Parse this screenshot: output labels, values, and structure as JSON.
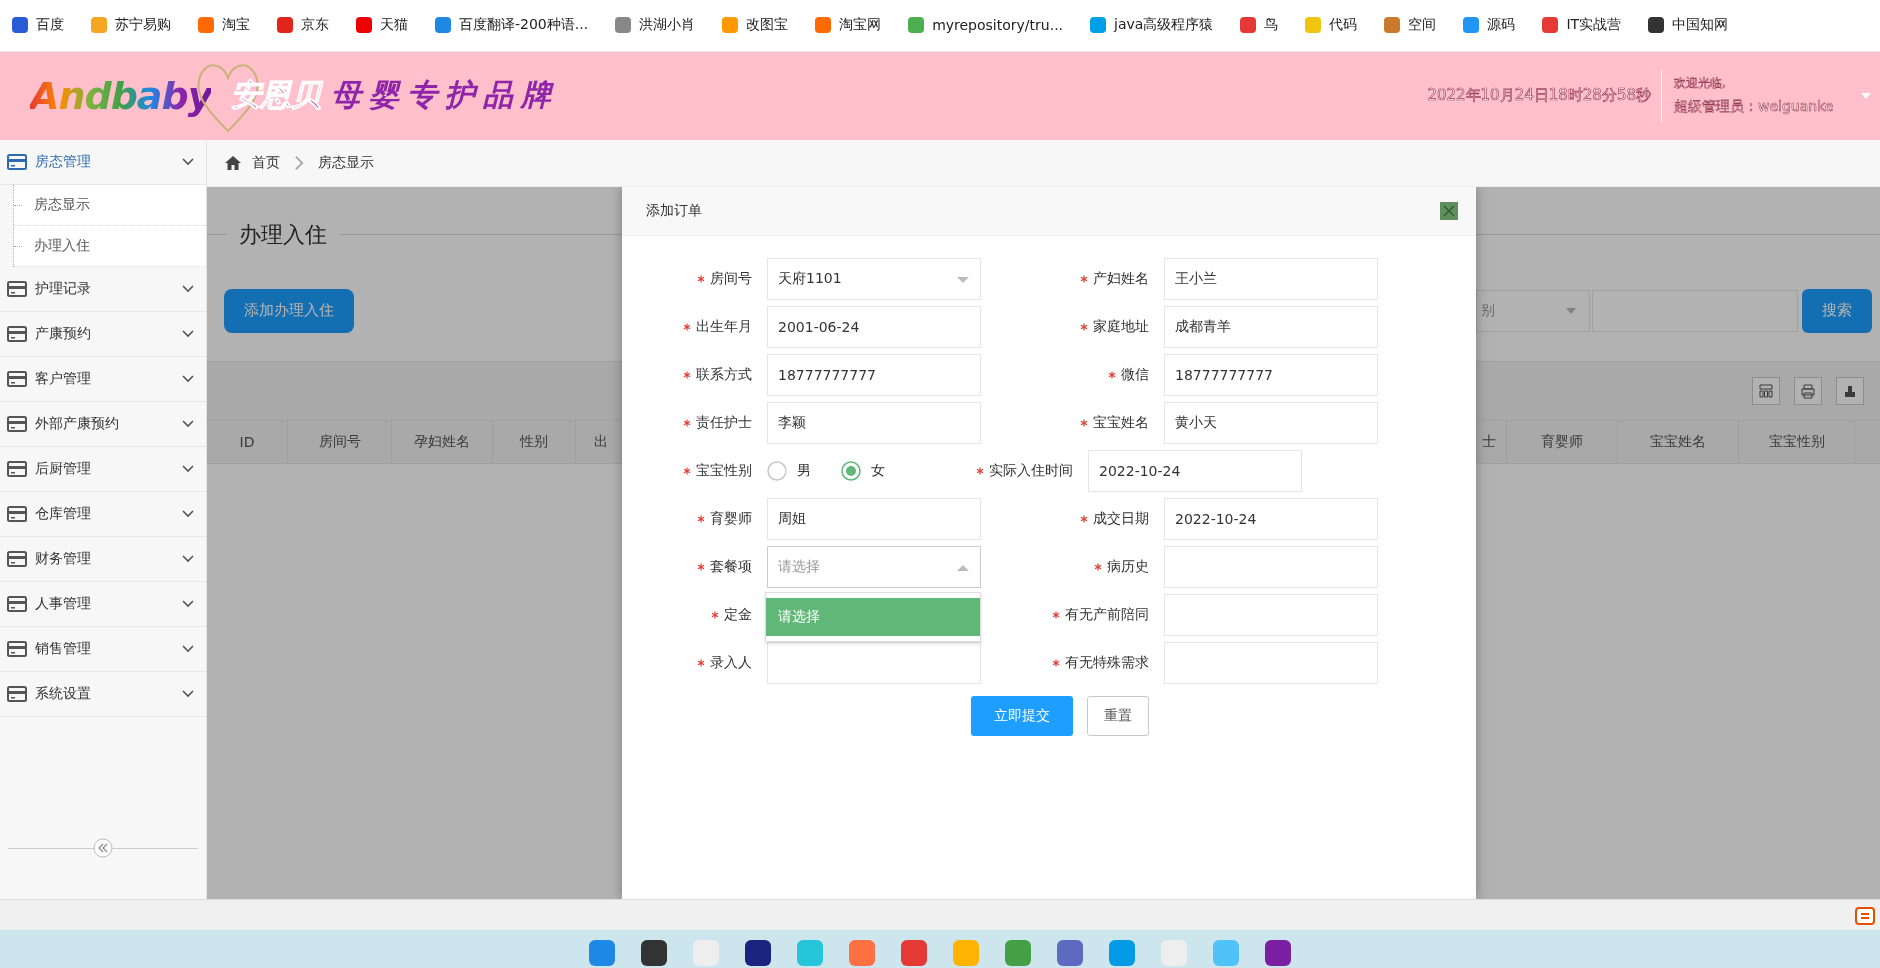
{
  "bookmarks": [
    "百度",
    "苏宁易购",
    "淘宝",
    "京东",
    "天猫",
    "百度翻译-200种语...",
    "洪湖小肖",
    "改图宝",
    "淘宝网",
    "myrepository/tru...",
    "java高级程序猿",
    "鸟",
    "代码",
    "空间",
    "源码",
    "IT实战营",
    "中国知网"
  ],
  "header": {
    "logo_text": "Andbaby",
    "logo_cn": "安恩贝",
    "slogan": "母婴专护品牌",
    "datetime": "2022年10月24日18时28分58秒",
    "welcome": "欢迎光临,",
    "user": "超级管理员：weiguanke"
  },
  "sidebar": {
    "items": [
      {
        "label": "房态管理",
        "selected": true,
        "children": [
          {
            "label": "房态显示",
            "selected": false
          },
          {
            "label": "办理入住",
            "selected": false
          }
        ]
      },
      {
        "label": "护理记录",
        "selected": false
      },
      {
        "label": "产康预约",
        "selected": false
      },
      {
        "label": "客户管理",
        "selected": false
      },
      {
        "label": "外部产康预约",
        "selected": false
      },
      {
        "label": "后厨管理",
        "selected": false
      },
      {
        "label": "仓库管理",
        "selected": false
      },
      {
        "label": "财务管理",
        "selected": false
      },
      {
        "label": "人事管理",
        "selected": false
      },
      {
        "label": "销售管理",
        "selected": false
      },
      {
        "label": "系统设置",
        "selected": false
      }
    ]
  },
  "breadcrumb": [
    "首页",
    "房态显示"
  ],
  "page": {
    "title": "办理入住",
    "add_button": "添加办理入住",
    "filter_select": "别",
    "search_button": "搜索",
    "columns_left": [
      "ID",
      "房间号",
      "孕妇姓名",
      "性别",
      "出"
    ],
    "columns_right": [
      "士",
      "育婴师",
      "宝宝姓名",
      "宝宝性别"
    ]
  },
  "dialog": {
    "title": "添加订单",
    "rows": [
      [
        {
          "label": "房间号",
          "kind": "select",
          "required": true,
          "expanded": false,
          "value": "天府1101"
        },
        {
          "label": "产妇姓名",
          "kind": "text",
          "required": true,
          "value": "王小兰"
        }
      ],
      [
        {
          "label": "出生年月",
          "kind": "text",
          "required": true,
          "value": "2001-06-24"
        },
        {
          "label": "家庭地址",
          "kind": "text",
          "required": true,
          "value": "成都青羊"
        }
      ],
      [
        {
          "label": "联系方式",
          "kind": "text",
          "required": true,
          "value": "18777777777"
        },
        {
          "label": "微信",
          "kind": "text",
          "required": true,
          "value": "18777777777"
        }
      ],
      [
        {
          "label": "责任护士",
          "kind": "text",
          "required": true,
          "value": "李颖"
        },
        {
          "label": "宝宝姓名",
          "kind": "text",
          "required": true,
          "value": "黄小天"
        }
      ],
      [
        {
          "label": "宝宝性别",
          "kind": "radio",
          "required": true,
          "options": [
            {
              "label": "男",
              "selected": false
            },
            {
              "label": "女",
              "selected": true
            }
          ]
        },
        {
          "label": "实际入住时间",
          "kind": "text",
          "required": true,
          "value": "2022-10-24"
        }
      ],
      [
        {
          "label": "育婴师",
          "kind": "text",
          "required": true,
          "value": "周姐"
        },
        {
          "label": "成交日期",
          "kind": "text",
          "required": true,
          "value": "2022-10-24"
        }
      ],
      [
        {
          "label": "套餐项",
          "kind": "select",
          "required": true,
          "expanded": true,
          "placeholder": "请选择",
          "options": [
            {
              "label": "请选择",
              "selected": true
            }
          ]
        },
        {
          "label": "病历史",
          "kind": "text",
          "required": true
        }
      ],
      [
        {
          "label": "定金",
          "kind": "text",
          "required": true
        },
        {
          "label": "有无产前陪同",
          "kind": "text",
          "required": true
        }
      ],
      [
        {
          "label": "录入人",
          "kind": "text",
          "required": true
        },
        {
          "label": "有无特殊需求",
          "kind": "text",
          "required": true
        }
      ]
    ],
    "submit": "立即提交",
    "reset": "重置"
  }
}
